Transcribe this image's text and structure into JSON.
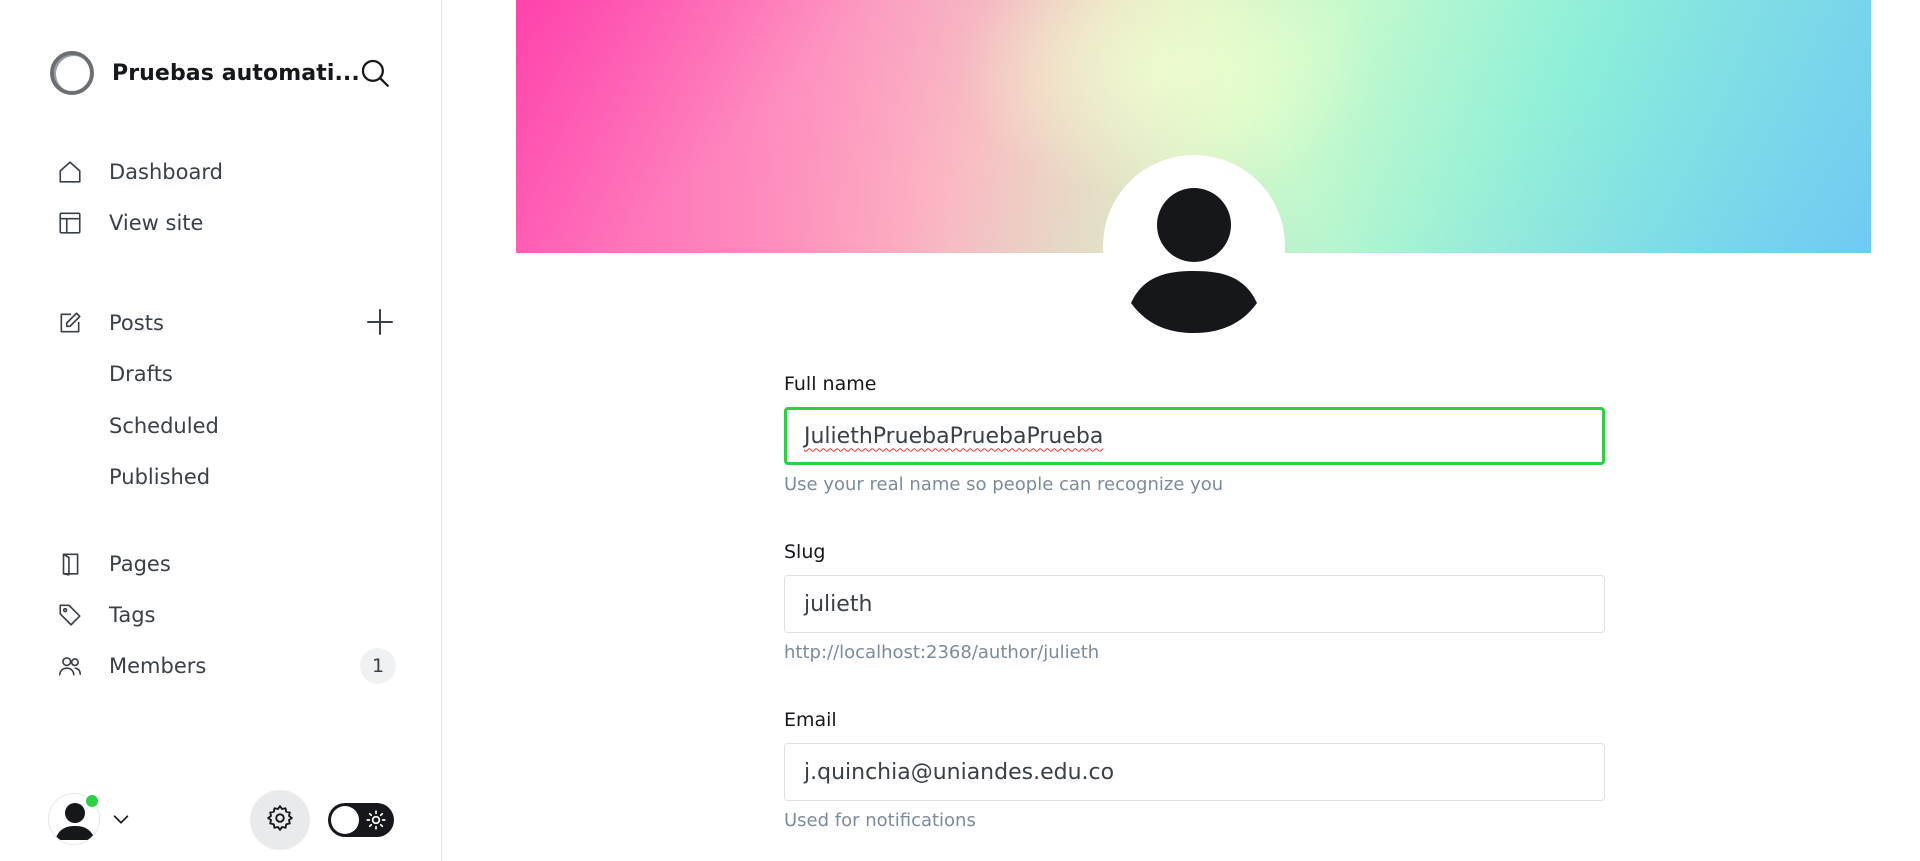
{
  "sidebar": {
    "site_title": "Pruebas automati...",
    "nav": {
      "dashboard": "Dashboard",
      "view_site": "View site",
      "posts": "Posts",
      "drafts": "Drafts",
      "scheduled": "Scheduled",
      "published": "Published",
      "pages": "Pages",
      "tags": "Tags",
      "members": "Members",
      "members_count": "1"
    }
  },
  "profile": {
    "full_name": {
      "label": "Full name",
      "value": "JuliethPruebaPruebaPrueba",
      "help": "Use your real name so people can recognize you"
    },
    "slug": {
      "label": "Slug",
      "value": "julieth",
      "help": "http://localhost:2368/author/julieth"
    },
    "email": {
      "label": "Email",
      "value": "j.quinchia@uniandes.edu.co",
      "help": "Used for notifications"
    }
  },
  "colors": {
    "focus_border": "#30cf43",
    "online_status": "#30cf43",
    "text_primary": "#15171a",
    "text_secondary": "#394047",
    "help_text": "#7c8b9a"
  },
  "icons": [
    "site-logo-icon",
    "search-icon",
    "home-icon",
    "layout-icon",
    "edit-icon",
    "plus-icon",
    "pages-icon",
    "tag-icon",
    "members-icon",
    "chevron-down-icon",
    "gear-icon",
    "sun-icon",
    "user-avatar-icon"
  ]
}
